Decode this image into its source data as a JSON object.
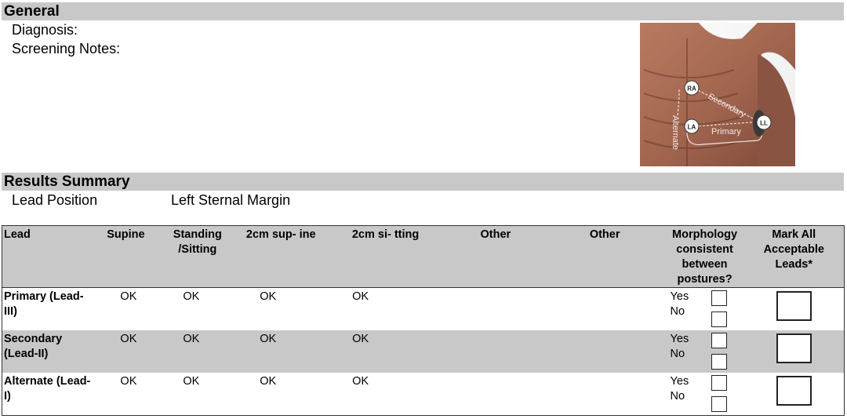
{
  "general": {
    "title": "General",
    "diagnosis_label": "Diagnosis:",
    "screening_notes_label": "Screening Notes:"
  },
  "figure": {
    "labels": {
      "ra": "RA",
      "la": "LA",
      "ll": "LL",
      "alternate": "Alternate",
      "secondary": "Secondary",
      "primary": "Primary"
    },
    "colors": {
      "skin": "#a86a52",
      "skin_dark": "#6a3a2c",
      "bg": "#ffffff"
    }
  },
  "results": {
    "title": "Results Summary",
    "lead_position_label": "Lead Position",
    "lead_position_value": "Left Sternal Margin",
    "columns": [
      "Lead",
      "Supine",
      "Standing /Sitting",
      "2cm sup- ine",
      "2cm si- tting",
      "Other",
      "Other",
      "Morphology consistent between postures?",
      "Mark All Acceptable Leads*"
    ],
    "rows": [
      {
        "lead": "Primary (Lead-III)",
        "supine": "OK",
        "standing": "OK",
        "sup2": "OK",
        "sit2": "OK",
        "other1": "",
        "other2": "",
        "yes": "Yes",
        "no": "No"
      },
      {
        "lead": "Secondary (Lead-II)",
        "supine": "OK",
        "standing": "OK",
        "sup2": "OK",
        "sit2": "OK",
        "other1": "",
        "other2": "",
        "yes": "Yes",
        "no": "No"
      },
      {
        "lead": "Alternate (Lead-I)",
        "supine": "OK",
        "standing": "OK",
        "sup2": "OK",
        "sit2": "OK",
        "other1": "",
        "other2": "",
        "yes": "Yes",
        "no": "No"
      }
    ],
    "shade_color": "#c8c8c8"
  }
}
